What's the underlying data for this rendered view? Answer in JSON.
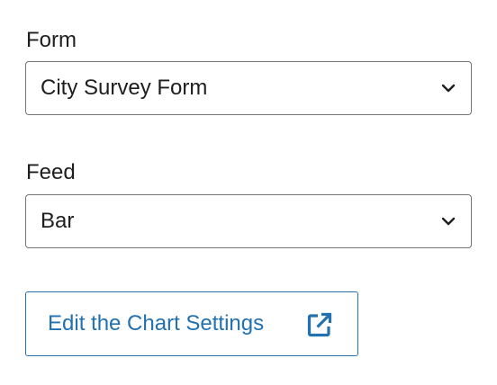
{
  "form": {
    "label": "Form",
    "selected": "City Survey Form",
    "icon": "chevron-down-icon"
  },
  "feed": {
    "label": "Feed",
    "selected": "Bar",
    "icon": "chevron-down-icon"
  },
  "edit_button": {
    "label": "Edit the Chart Settings",
    "icon": "external-link-icon"
  },
  "colors": {
    "text": "#1e1e1e",
    "border": "#757575",
    "accent": "#2271b1",
    "background": "#ffffff"
  }
}
